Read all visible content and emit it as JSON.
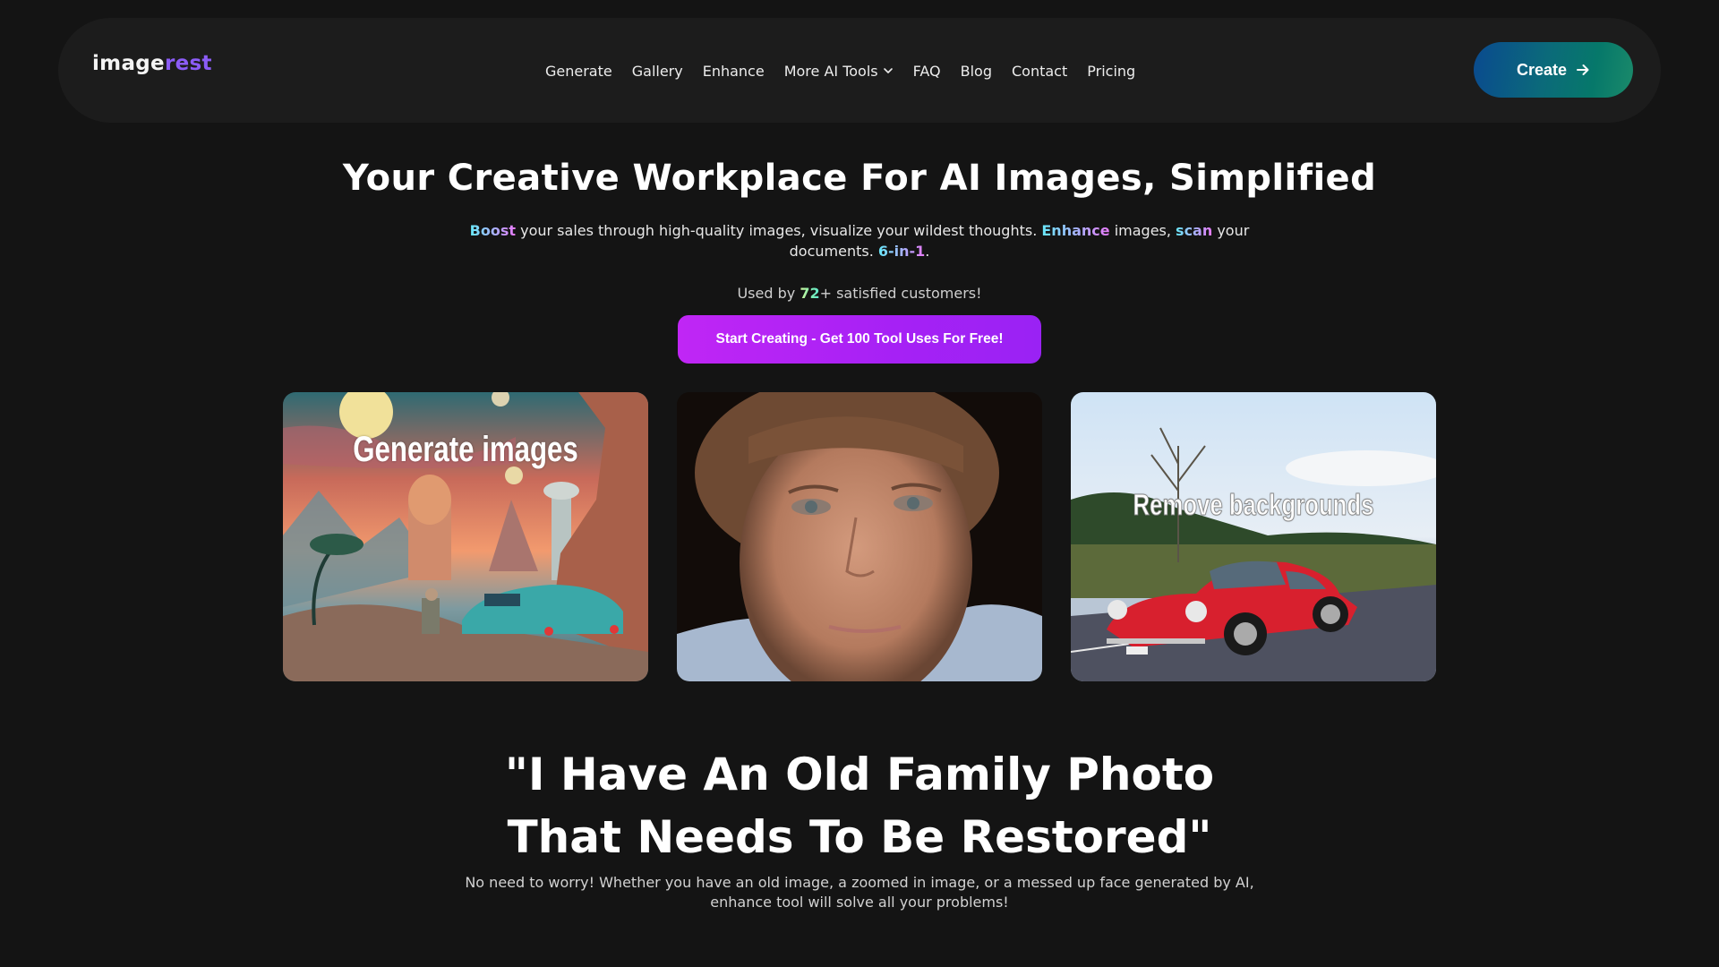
{
  "header": {
    "logo": {
      "part1": "image",
      "part2": "rest"
    },
    "nav": [
      {
        "label": "Generate"
      },
      {
        "label": "Gallery"
      },
      {
        "label": "Enhance"
      },
      {
        "label": "More AI Tools",
        "has_dropdown": true
      },
      {
        "label": "FAQ"
      },
      {
        "label": "Blog"
      },
      {
        "label": "Contact"
      },
      {
        "label": "Pricing"
      }
    ],
    "create_button": {
      "label": "Create",
      "icon": "arrow-right-icon"
    }
  },
  "hero": {
    "title": "Your Creative Workplace For AI Images, Simplified",
    "subtitle": {
      "boost": "Boost",
      "t1": " your sales through high-quality images, visualize your wildest thoughts. ",
      "enhance": "Enhance",
      "t2": " images, ",
      "scan": "scan",
      "t3": " your documents. ",
      "six_in_one": "6-in-1",
      "t4": "."
    },
    "used_by": {
      "prefix": "Used by ",
      "count": "72",
      "suffix": "+ satisfied customers!"
    },
    "cta_label": "Start Creating - Get 100 Tool Uses For Free!"
  },
  "showcase": [
    {
      "label": "Generate images",
      "alt": "Retro sci-fi landscape with teal car"
    },
    {
      "label": "",
      "alt": "Enhanced face portrait"
    },
    {
      "label": "Remove backgrounds",
      "alt": "Red sports car on road"
    }
  ],
  "section2": {
    "heading_line1": "\"I Have An Old Family Photo",
    "heading_line2": "That Needs To Be Restored\"",
    "body": "No need to worry! Whether you have an old image, a zoomed in image, or a messed up face generated by AI, enhance tool will solve all your problems!"
  },
  "colors": {
    "page_bg": "#141414",
    "nav_bg": "#1c1c1c",
    "logo_accent": "#8b5cf6",
    "cta_start": "#c026f5",
    "cta_end": "#9a22f4",
    "create_start": "#0a4a8f",
    "create_end": "#1b8a6a"
  }
}
